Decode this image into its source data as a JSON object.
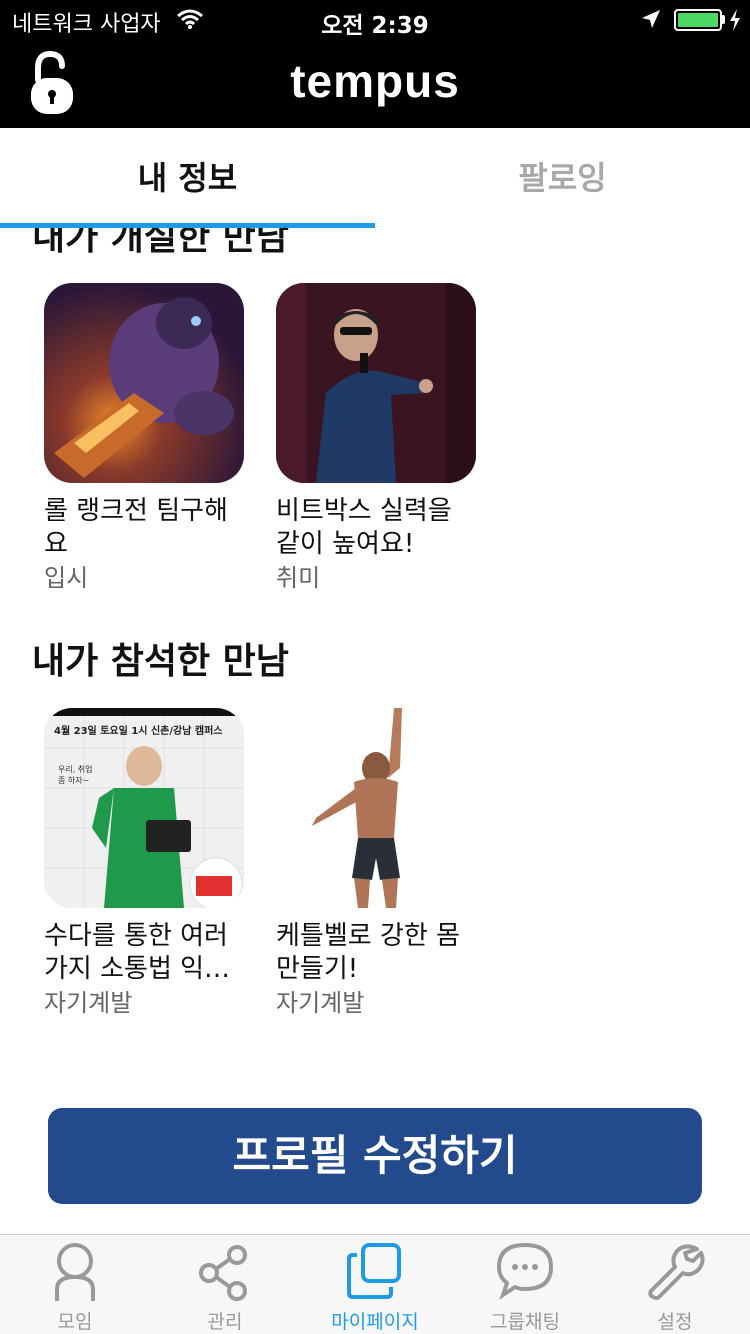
{
  "status_bar": {
    "carrier": "네트워크 사업자",
    "time": "오전 2:39",
    "battery_level": 1.0,
    "battery_color": "#4cd964"
  },
  "navbar": {
    "title": "tempus",
    "left_icon": "unlock-icon"
  },
  "tabs": {
    "items": [
      {
        "label": "내 정보",
        "active": true
      },
      {
        "label": "팔로잉",
        "active": false
      }
    ],
    "indicator_color": "#1e9be6"
  },
  "sections": [
    {
      "title": "내가 개설한 만남",
      "cards": [
        {
          "name": "롤 랭크전 팀구해요",
          "category": "입시",
          "thumb": "game-character-thumbnail"
        },
        {
          "name": "비트박스 실력을 같이 높여요!",
          "category": "취미",
          "thumb": "beatbox-performer-thumbnail"
        }
      ]
    },
    {
      "title": "내가 참석한 만남",
      "cards": [
        {
          "name": "수다를 통한 여러 가지 소통법 익…",
          "category": "자기계발",
          "thumb": "event-poster-thumbnail",
          "poster_text": "4월 23일 토요일 1시 신촌/강남 캠퍼스",
          "poster_side": "우리, 취업 좀 하자~"
        },
        {
          "name": "케틀벨로 강한 몸 만들기!",
          "category": "자기계발",
          "thumb": "athlete-thumbnail"
        }
      ]
    }
  ],
  "edit_button": {
    "label": "프로필 수정하기",
    "color": "#234a8c"
  },
  "tabbar": {
    "items": [
      {
        "label": "모임",
        "icon": "person-icon",
        "active": false
      },
      {
        "label": "관리",
        "icon": "share-icon",
        "active": false
      },
      {
        "label": "마이페이지",
        "icon": "squares-icon",
        "active": true
      },
      {
        "label": "그룹채팅",
        "icon": "chat-bubble-icon",
        "active": false
      },
      {
        "label": "설정",
        "icon": "wrench-icon",
        "active": false
      }
    ],
    "active_color": "#1e9be6"
  }
}
